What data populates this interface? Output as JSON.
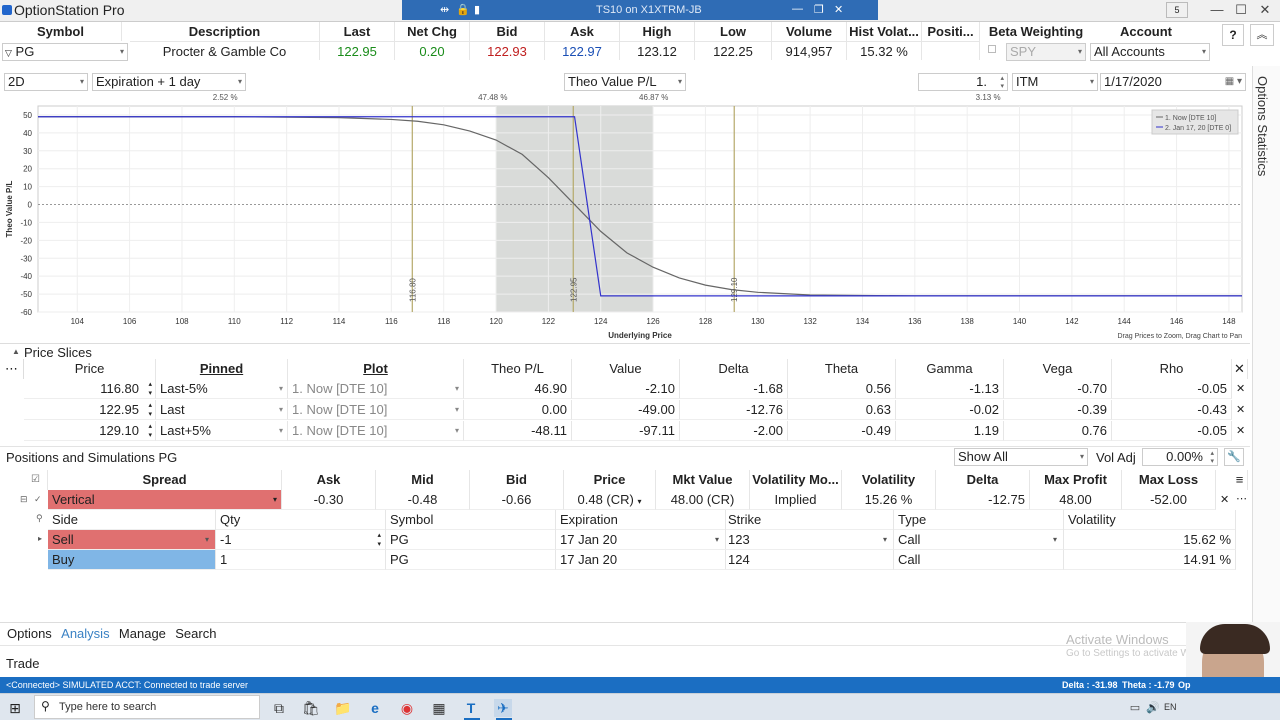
{
  "app": {
    "title": "OptionStation Pro",
    "remote_title": "TS10 on X1XTRM-JB",
    "menu_badge": "5"
  },
  "quote": {
    "headers": [
      "Symbol",
      "Description",
      "Last",
      "Net Chg",
      "Bid",
      "Ask",
      "High",
      "Low",
      "Volume",
      "Hist Volat...",
      "Positi...",
      "Beta Weighting",
      "Account"
    ],
    "symbol": "PG",
    "description": "Procter & Gamble Co",
    "last": "122.95",
    "net_chg": "0.20",
    "bid": "122.93",
    "ask": "122.97",
    "high": "123.12",
    "low": "122.25",
    "volume": "914,957",
    "hist_vol": "15.32 %",
    "beta_symbol": "SPY",
    "account": "All Accounts",
    "help_label": "?"
  },
  "toolbar": {
    "view": "2D",
    "horizon": "Expiration + 1 day",
    "measure": "Theo Value P/L",
    "count": "1.",
    "moneyness": "ITM",
    "date": "1/17/2020"
  },
  "side_panel": {
    "label": "Options Statistics"
  },
  "chart_data": {
    "type": "line",
    "xlabel": "Underlying Price",
    "ylabel": "Theo Value P/L",
    "xlim": [
      102.5,
      148.5
    ],
    "ylim": [
      -60,
      55
    ],
    "xticks": [
      104,
      106,
      108,
      110,
      112,
      114,
      116,
      118,
      120,
      122,
      124,
      126,
      128,
      130,
      132,
      134,
      136,
      138,
      140,
      142,
      144,
      146,
      148
    ],
    "yticks": [
      50,
      40,
      30,
      20,
      10,
      0,
      -10,
      -20,
      -30,
      -40,
      -50,
      -60
    ],
    "zones": [
      {
        "from": 102.5,
        "to": 116.8,
        "pct": "2.52 %"
      },
      {
        "from": 116.8,
        "to": 122.95,
        "pct": "47.48 %"
      },
      {
        "from": 122.95,
        "to": 129.1,
        "pct": "46.87 %"
      },
      {
        "from": 129.1,
        "to": 148.5,
        "pct": "3.13 %"
      }
    ],
    "shaded_range": [
      120,
      126
    ],
    "markers": [
      {
        "x": 116.8,
        "label": "116.80"
      },
      {
        "x": 122.95,
        "label": "122.95"
      },
      {
        "x": 129.1,
        "label": "129.10"
      }
    ],
    "series": [
      {
        "name": "1. Now [DTE 10]",
        "color": "#666666",
        "x": [
          102.5,
          110,
          114,
          116,
          117,
          118,
          119,
          120,
          121,
          122,
          123,
          124,
          125,
          126,
          127,
          128,
          129,
          130,
          132,
          136,
          148.5
        ],
        "y": [
          49,
          49,
          48.5,
          47.5,
          46.5,
          44.5,
          41,
          36,
          28,
          15,
          0,
          -15,
          -27,
          -35,
          -41,
          -45,
          -47.5,
          -49,
          -50.5,
          -51,
          -51
        ]
      },
      {
        "name": "2. Jan 17, 20 [DTE 0]",
        "color": "#3333cc",
        "x": [
          102.5,
          123,
          124,
          148.5
        ],
        "y": [
          49,
          49,
          -51,
          -51
        ]
      }
    ],
    "hint_lines": [
      "Drag Prices to Zoom, Drag Chart to Pan"
    ]
  },
  "price_slices": {
    "title": "Price Slices",
    "headers": [
      "Price",
      "Pinned",
      "Plot",
      "Theo P/L",
      "Value",
      "Delta",
      "Theta",
      "Gamma",
      "Vega",
      "Rho"
    ],
    "rows": [
      [
        "116.80",
        "Last-5%",
        "1. Now [DTE 10]",
        "46.90",
        "-2.10",
        "-1.68",
        "0.56",
        "-1.13",
        "-0.70",
        "-0.05"
      ],
      [
        "122.95",
        "Last",
        "1. Now [DTE 10]",
        "0.00",
        "-49.00",
        "-12.76",
        "0.63",
        "-0.02",
        "-0.39",
        "-0.43"
      ],
      [
        "129.10",
        "Last+5%",
        "1. Now [DTE 10]",
        "-48.11",
        "-97.11",
        "-2.00",
        "-0.49",
        "1.19",
        "0.76",
        "-0.05"
      ]
    ]
  },
  "positions": {
    "title": "Positions and Simulations",
    "symbol": "PG",
    "filter": "Show All",
    "vol_adj_label": "Vol Adj",
    "vol_adj": "0.00%",
    "headers": [
      "Spread",
      "Ask",
      "Mid",
      "Bid",
      "Price",
      "Mkt Value",
      "Volatility Mo...",
      "Volatility",
      "Delta",
      "Max Profit",
      "Max Loss"
    ],
    "spread": {
      "name": "Vertical",
      "ask": "-0.30",
      "mid": "-0.48",
      "bid": "-0.66",
      "price": "0.48 (CR)",
      "mkt_value": "48.00 (CR)",
      "vol_model": "Implied",
      "volatility": "15.26 %",
      "delta": "-12.75",
      "max_profit": "48.00",
      "max_loss": "-52.00"
    },
    "leg_headers": [
      "Side",
      "Qty",
      "Symbol",
      "Expiration",
      "Strike",
      "Type",
      "Volatility"
    ],
    "legs": [
      {
        "side": "Sell",
        "qty": "-1",
        "symbol": "PG",
        "exp": "17 Jan 20",
        "strike": "123",
        "type": "Call",
        "vol": "15.62 %",
        "color": "#e07070"
      },
      {
        "side": "Buy",
        "qty": "1",
        "symbol": "PG",
        "exp": "17 Jan 20",
        "strike": "124",
        "type": "Call",
        "vol": "14.91 %",
        "color": "#80b6e6"
      }
    ]
  },
  "bottom_tabs": [
    "Options",
    "Analysis",
    "Manage",
    "Search"
  ],
  "trade_label": "Trade",
  "watermark": {
    "line1": "Activate Windows",
    "line2": "Go to Settings to activate Windows."
  },
  "status": {
    "left": "<Connected> SIMULATED ACCT: Connected to trade server",
    "delta": "Delta : -31.98",
    "theta": "Theta : -1.79",
    "extra": "Op"
  },
  "taskbar": {
    "search_placeholder": "Type here to search",
    "lang": "EN"
  }
}
